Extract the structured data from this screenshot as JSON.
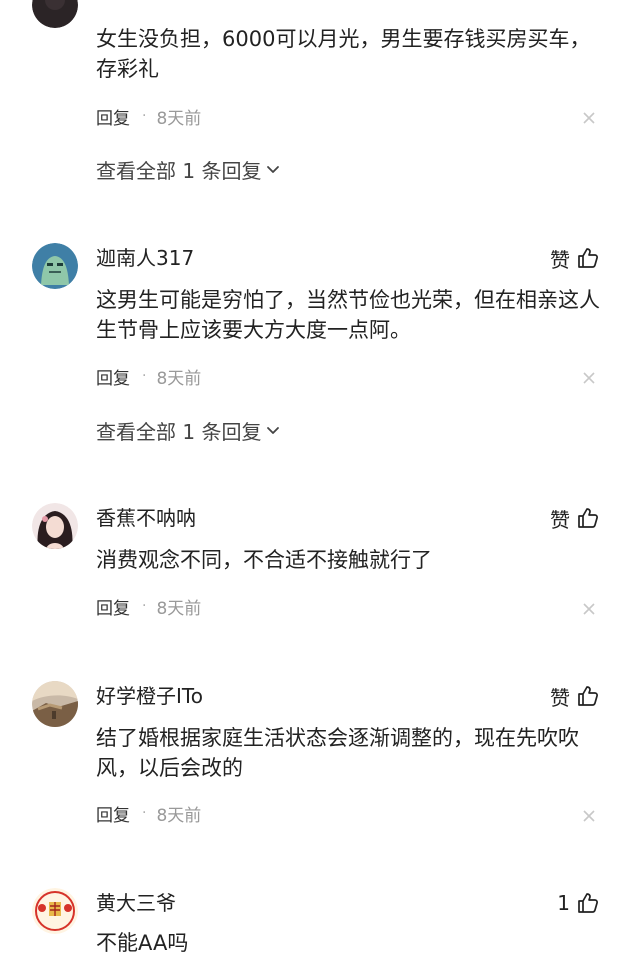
{
  "comments": [
    {
      "username": "",
      "text_lines": [
        "女生没负担，6000可以月光，男生要存钱买房买车，",
        "存彩礼"
      ],
      "reply_label": "回复",
      "time": "8天前",
      "view_replies": "查看全部 1 条回复"
    },
    {
      "username": "迦南人317",
      "like_label": "赞",
      "text_lines": [
        "这男生可能是穷怕了，当然节俭也光荣，但在相亲这人",
        "生节骨上应该要大方大度一点阿。"
      ],
      "reply_label": "回复",
      "time": "8天前",
      "view_replies": "查看全部 1 条回复"
    },
    {
      "username": "香蕉不呐呐",
      "like_label": "赞",
      "text_lines": [
        "消费观念不同，不合适不接触就行了"
      ],
      "reply_label": "回复",
      "time": "8天前"
    },
    {
      "username": "好学橙子ITo",
      "like_label": "赞",
      "text_lines": [
        "结了婚根据家庭生活状态会逐渐调整的，现在先吹吹",
        "风，以后会改的"
      ],
      "reply_label": "回复",
      "time": "8天前"
    },
    {
      "username": "黄大三爷",
      "like_label": "1",
      "text_lines": [
        "不能AA吗"
      ]
    }
  ],
  "icons": {
    "like": "thumbs-up-icon",
    "close": "close-icon",
    "chevron": "chevron-down-icon"
  },
  "colors": {
    "text": "#222222",
    "meta_time": "#999999",
    "close": "#c8c8c8"
  }
}
